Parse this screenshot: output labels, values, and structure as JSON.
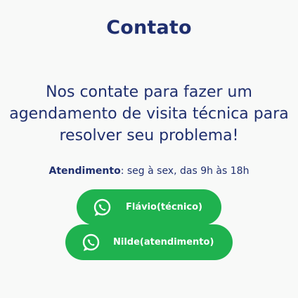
{
  "contact": {
    "title": "Contato",
    "lead_line1": "Nos contate para fazer um",
    "lead_line2": "agendamento de visita técnica para",
    "lead_line3": "resolver seu problema!",
    "hours_label": "Atendimento",
    "hours_value": ": seg à sex, das 9h às 18h",
    "buttons": [
      {
        "label": "Flávio(técnico)",
        "icon": "whatsapp-icon"
      },
      {
        "label": "Nilde(atendimento)",
        "icon": "whatsapp-icon"
      }
    ]
  },
  "colors": {
    "background": "#f8f9f8",
    "text": "#1f2f6e",
    "button": "#1fb24f",
    "button_text": "#ffffff"
  }
}
